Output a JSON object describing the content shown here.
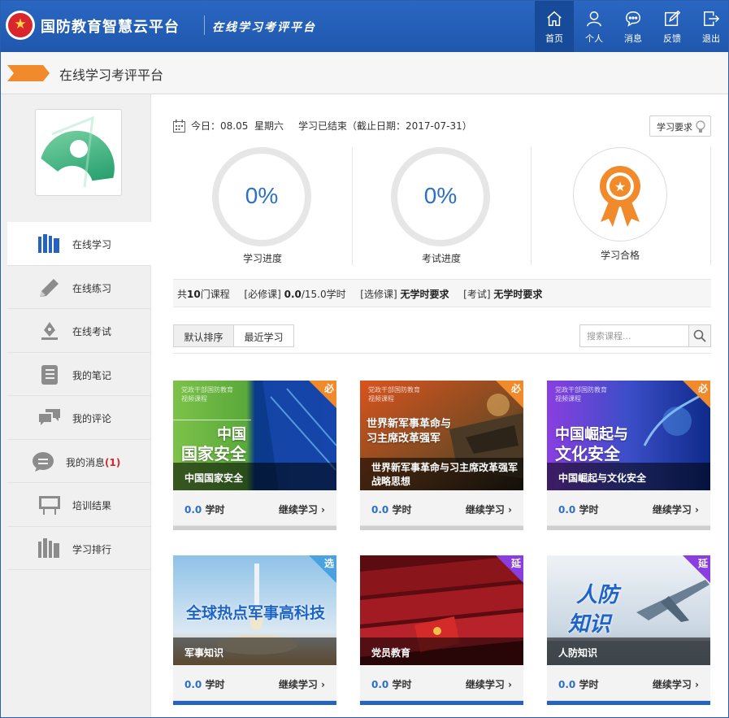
{
  "header": {
    "brand": "国防教育智慧云平台",
    "subtitle": "在线学习考评平台",
    "nav": [
      {
        "label": "首页",
        "icon": "home-icon",
        "active": true
      },
      {
        "label": "个人",
        "icon": "user-icon"
      },
      {
        "label": "消息",
        "icon": "message-icon"
      },
      {
        "label": "反馈",
        "icon": "feedback-icon"
      },
      {
        "label": "退出",
        "icon": "logout-icon"
      }
    ]
  },
  "subheader": {
    "title": "在线学习考评平台"
  },
  "sidebar": {
    "items": [
      {
        "label": "在线学习",
        "icon": "books-icon",
        "active": true
      },
      {
        "label": "在线练习",
        "icon": "pencil-icon"
      },
      {
        "label": "在线考试",
        "icon": "pen-nib-icon"
      },
      {
        "label": "我的笔记",
        "icon": "notebook-icon"
      },
      {
        "label": "我的评论",
        "icon": "comments-icon"
      },
      {
        "label": "我的消息",
        "badge": "(1)",
        "icon": "chat-bubble-icon"
      },
      {
        "label": "培训结果",
        "icon": "easel-icon"
      },
      {
        "label": "学习排行",
        "icon": "ranking-icon"
      }
    ]
  },
  "status": {
    "today": "今日：08.05  星期六",
    "ended": "学习已结束（截止日期：2017-07-31）",
    "requirements_button": "学习要求"
  },
  "stats": [
    {
      "value": "0%",
      "label": "学习进度"
    },
    {
      "value": "0%",
      "label": "考试进度"
    },
    {
      "label": "学习合格"
    }
  ],
  "summary": {
    "total_prefix": "共",
    "total_count": "10",
    "total_suffix": "门课程",
    "required_tag": "[必修课]",
    "required_done": "0.0",
    "required_total": "/15.0学时",
    "elective_tag": "[选修课]",
    "elective_value": "无学时要求",
    "exam_tag": "[考试]",
    "exam_value": "无学时要求"
  },
  "sort": {
    "default": "默认排序",
    "recent": "最近学习",
    "search_placeholder": "搜索课程..."
  },
  "courses": [
    {
      "title": "中国国家安全",
      "hours": "0.0",
      "unit": "学时",
      "action": "继续学习",
      "tag": "必",
      "img_title_1": "中国",
      "img_title_2": "国家安全",
      "img_small": "党政干部国防教育\n视频课程"
    },
    {
      "title": "世界新军事革命与习主席改革强军战略思想",
      "hours": "0.0",
      "unit": "学时",
      "action": "继续学习",
      "tag": "必",
      "img_title_1": "世界新军事革命与",
      "img_title_2": "习主席改革强军",
      "img_small": "党政干部国防教育\n视频课程"
    },
    {
      "title": "中国崛起与文化安全",
      "hours": "0.0",
      "unit": "学时",
      "action": "继续学习",
      "tag": "必",
      "img_title_1": "中国崛起与",
      "img_title_2": "文化安全",
      "img_small": "党政干部国防教育\n视频课程"
    },
    {
      "title": "军事知识",
      "hours": "0.0",
      "unit": "学时",
      "action": "继续学习",
      "tag": "选",
      "img_title_1": "全球热点军事高科技"
    },
    {
      "title": "党员教育",
      "hours": "0.0",
      "unit": "学时",
      "action": "继续学习",
      "tag": "延"
    },
    {
      "title": "人防知识",
      "hours": "0.0",
      "unit": "学时",
      "action": "继续学习",
      "tag": "延",
      "img_title_1": "人防",
      "img_title_2": "知识"
    }
  ],
  "colors": {
    "brand_blue": "#2a67c2",
    "accent_orange": "#f08a2a",
    "link_blue": "#2b6fc9",
    "badge_red": "#d8262c"
  }
}
